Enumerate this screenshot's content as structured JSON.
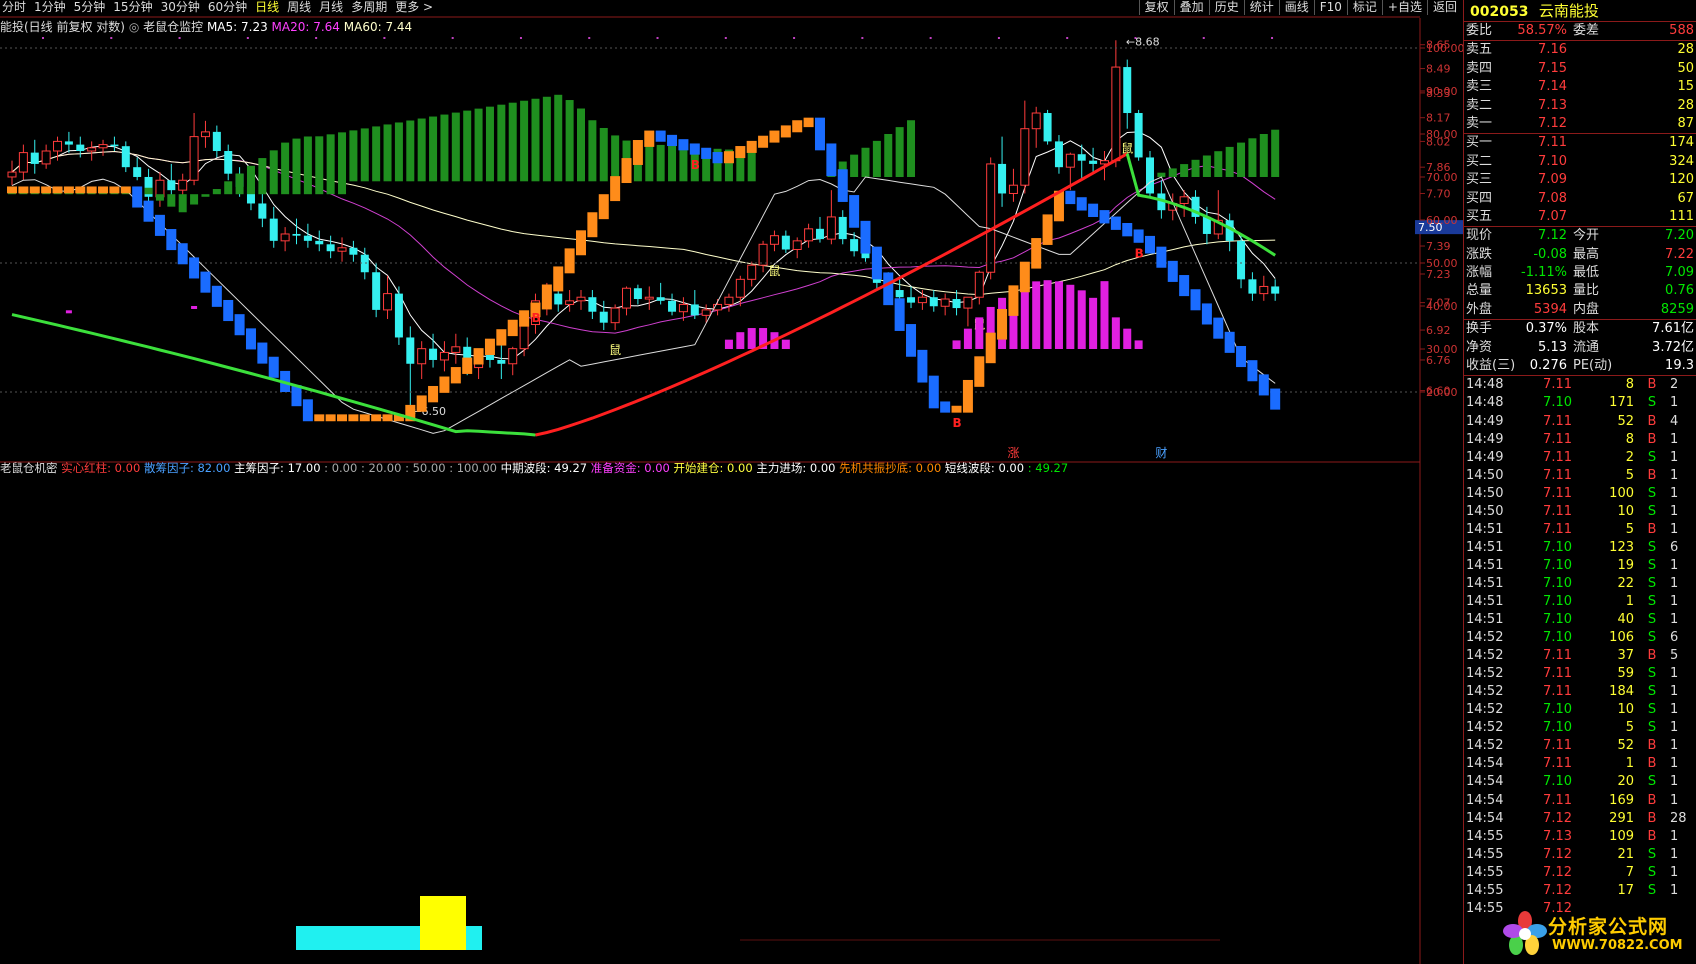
{
  "toolbar": {
    "periods": [
      "分时",
      "1分钟",
      "5分钟",
      "15分钟",
      "30分钟",
      "60分钟",
      "日线",
      "周线",
      "月线",
      "多周期",
      "更多 >"
    ],
    "active_period": "日线",
    "tools": [
      "复权",
      "叠加",
      "历史",
      "统计",
      "画线",
      "F10",
      "标记",
      "+自选",
      "返回"
    ]
  },
  "price_pane": {
    "legend_title": "能投(日线 前复权 对数)",
    "indicator_name": "老鼠仓监控",
    "ma5": "MA5: 7.23",
    "ma20": "MA20: 7.64",
    "ma60": "MA60: 7.44",
    "price_scale": [
      "8.65",
      "8.49",
      "8.33",
      "8.17",
      "8.02",
      "7.86",
      "7.70",
      "7.39",
      "7.23",
      "7.07",
      "6.92",
      "6.76",
      "6.60"
    ],
    "current_price_tag": "7.50",
    "high_marker": "8.68",
    "low_marker": "6.50",
    "mouse_signal_label": "鼠",
    "signal_zhang": "涨",
    "signal_cai": "财"
  },
  "indicator_pane": {
    "title": "老鼠仓机密",
    "params": [
      {
        "label": "实心红柱:",
        "value": "0.00",
        "color": "#ff3c3c"
      },
      {
        "label": "散筹因子:",
        "value": "82.00",
        "color": "#4aa0ff"
      },
      {
        "label": "主筹因子:",
        "value": "17.00",
        "color": "#ffffff"
      },
      {
        "label": ":",
        "value": "0.00",
        "color": "#aaaaaa"
      },
      {
        "label": ":",
        "value": "20.00",
        "color": "#aaaaaa"
      },
      {
        "label": ":",
        "value": "50.00",
        "color": "#aaaaaa"
      },
      {
        "label": ":",
        "value": "100.00",
        "color": "#aaaaaa"
      },
      {
        "label": "中期波段:",
        "value": "49.27",
        "color": "#ffffff"
      },
      {
        "label": "准备资金:",
        "value": "0.00",
        "color": "#ff40ff"
      },
      {
        "label": "开始建仓:",
        "value": "0.00",
        "color": "#ffff40"
      },
      {
        "label": "主力进场:",
        "value": "0.00",
        "color": "#ffffff"
      },
      {
        "label": "先机共振抄底:",
        "value": "0.00",
        "color": "#ff8800"
      },
      {
        "label": "短线波段:",
        "value": "0.00",
        "color": "#ffffff"
      },
      {
        "label": ":",
        "value": "49.27",
        "color": "#00e600"
      }
    ],
    "scale": [
      "100.00",
      "90.00",
      "80.00",
      "70.00",
      "60.00",
      "50.00",
      "40.00",
      "30.00",
      "20.00"
    ],
    "buy_label": "B"
  },
  "chart_data": {
    "type": "candlestick",
    "price_axis": {
      "scale": "log",
      "range": [
        6.45,
        8.75
      ]
    },
    "candles": [
      [
        7.8,
        7.9,
        7.75,
        7.83
      ],
      [
        7.83,
        8.0,
        7.78,
        7.95
      ],
      [
        7.95,
        8.03,
        7.82,
        7.88
      ],
      [
        7.88,
        8.0,
        7.85,
        7.96
      ],
      [
        7.96,
        8.05,
        7.9,
        8.02
      ],
      [
        8.02,
        8.08,
        7.95,
        8.0
      ],
      [
        8.0,
        8.05,
        7.92,
        7.96
      ],
      [
        7.96,
        8.02,
        7.9,
        7.98
      ],
      [
        7.98,
        8.03,
        7.93,
        8.0
      ],
      [
        8.0,
        8.05,
        7.96,
        7.99
      ],
      [
        7.99,
        8.02,
        7.83,
        7.86
      ],
      [
        7.86,
        7.92,
        7.78,
        7.8
      ],
      [
        7.8,
        7.85,
        7.65,
        7.68
      ],
      [
        7.68,
        7.83,
        7.62,
        7.78
      ],
      [
        7.78,
        7.88,
        7.68,
        7.72
      ],
      [
        7.72,
        7.82,
        7.65,
        7.78
      ],
      [
        7.78,
        8.2,
        7.75,
        8.05
      ],
      [
        8.05,
        8.15,
        7.98,
        8.08
      ],
      [
        8.08,
        8.12,
        7.92,
        7.96
      ],
      [
        7.96,
        8.0,
        7.78,
        7.82
      ],
      [
        7.82,
        7.86,
        7.68,
        7.74
      ],
      [
        7.74,
        7.8,
        7.6,
        7.64
      ],
      [
        7.64,
        7.72,
        7.5,
        7.55
      ],
      [
        7.55,
        7.62,
        7.38,
        7.42
      ],
      [
        7.42,
        7.5,
        7.36,
        7.46
      ],
      [
        7.46,
        7.55,
        7.4,
        7.45
      ],
      [
        7.45,
        7.52,
        7.38,
        7.42
      ],
      [
        7.42,
        7.48,
        7.36,
        7.4
      ],
      [
        7.4,
        7.45,
        7.32,
        7.36
      ],
      [
        7.36,
        7.44,
        7.3,
        7.38
      ],
      [
        7.38,
        7.42,
        7.3,
        7.34
      ],
      [
        7.34,
        7.38,
        7.2,
        7.24
      ],
      [
        7.24,
        7.29,
        6.99,
        7.03
      ],
      [
        7.03,
        7.22,
        6.98,
        7.12
      ],
      [
        7.12,
        7.16,
        6.84,
        6.88
      ],
      [
        6.88,
        6.94,
        6.5,
        6.74
      ],
      [
        6.74,
        6.86,
        6.66,
        6.82
      ],
      [
        6.82,
        6.9,
        6.72,
        6.76
      ],
      [
        6.76,
        6.86,
        6.7,
        6.8
      ],
      [
        6.8,
        6.9,
        6.74,
        6.83
      ],
      [
        6.83,
        6.88,
        6.68,
        6.72
      ],
      [
        6.72,
        6.82,
        6.66,
        6.79
      ],
      [
        6.79,
        6.86,
        6.72,
        6.76
      ],
      [
        6.76,
        6.88,
        6.66,
        6.74
      ],
      [
        6.74,
        6.83,
        6.68,
        6.82
      ],
      [
        6.82,
        6.98,
        6.78,
        6.95
      ],
      [
        6.95,
        7.12,
        6.9,
        7.08
      ],
      [
        7.08,
        7.18,
        7.0,
        7.12
      ],
      [
        7.12,
        7.16,
        7.02,
        7.06
      ],
      [
        7.06,
        7.14,
        7.02,
        7.08
      ],
      [
        7.08,
        7.14,
        7.03,
        7.1
      ],
      [
        7.1,
        7.14,
        6.98,
        7.02
      ],
      [
        7.02,
        7.08,
        6.92,
        6.96
      ],
      [
        6.96,
        7.06,
        6.92,
        7.04
      ],
      [
        7.04,
        7.16,
        7.0,
        7.15
      ],
      [
        7.15,
        7.17,
        7.06,
        7.09
      ],
      [
        7.09,
        7.16,
        7.03,
        7.1
      ],
      [
        7.1,
        7.18,
        7.06,
        7.08
      ],
      [
        7.08,
        7.12,
        7.0,
        7.02
      ],
      [
        7.02,
        7.1,
        6.97,
        7.06
      ],
      [
        7.06,
        7.14,
        6.98,
        7.0
      ],
      [
        7.0,
        7.06,
        6.96,
        7.03
      ],
      [
        7.03,
        7.09,
        7.0,
        7.06
      ],
      [
        7.06,
        7.12,
        7.02,
        7.1
      ],
      [
        7.1,
        7.22,
        7.05,
        7.2
      ],
      [
        7.2,
        7.3,
        7.16,
        7.28
      ],
      [
        7.28,
        7.42,
        7.24,
        7.4
      ],
      [
        7.4,
        7.48,
        7.36,
        7.45
      ],
      [
        7.45,
        7.48,
        7.35,
        7.37
      ],
      [
        7.37,
        7.44,
        7.32,
        7.42
      ],
      [
        7.42,
        7.52,
        7.38,
        7.49
      ],
      [
        7.49,
        7.56,
        7.41,
        7.43
      ],
      [
        7.43,
        7.72,
        7.4,
        7.56
      ],
      [
        7.56,
        7.6,
        7.4,
        7.43
      ],
      [
        7.43,
        7.47,
        7.33,
        7.36
      ],
      [
        7.36,
        7.42,
        7.3,
        7.32
      ],
      [
        7.32,
        7.35,
        7.15,
        7.18
      ],
      [
        7.18,
        7.24,
        7.1,
        7.14
      ],
      [
        7.14,
        7.2,
        7.06,
        7.1
      ],
      [
        7.1,
        7.16,
        7.04,
        7.07
      ],
      [
        7.07,
        7.14,
        7.03,
        7.1
      ],
      [
        7.1,
        7.14,
        7.02,
        7.05
      ],
      [
        7.05,
        7.12,
        7.0,
        7.09
      ],
      [
        7.09,
        7.14,
        7.0,
        7.04
      ],
      [
        7.04,
        7.08,
        6.94,
        7.1
      ],
      [
        7.1,
        7.25,
        7.06,
        7.24
      ],
      [
        7.24,
        7.92,
        7.2,
        7.88
      ],
      [
        7.88,
        8.05,
        7.62,
        7.7
      ],
      [
        7.7,
        7.85,
        7.65,
        7.75
      ],
      [
        7.75,
        8.28,
        7.7,
        8.1
      ],
      [
        8.1,
        8.24,
        7.98,
        8.2
      ],
      [
        8.2,
        8.22,
        8.0,
        8.02
      ],
      [
        8.02,
        8.06,
        7.82,
        7.86
      ],
      [
        7.86,
        7.95,
        7.72,
        7.94
      ],
      [
        7.94,
        8.0,
        7.78,
        7.9
      ],
      [
        7.9,
        7.98,
        7.82,
        7.88
      ],
      [
        7.88,
        7.96,
        7.78,
        7.9
      ],
      [
        7.9,
        8.68,
        7.86,
        8.5
      ],
      [
        8.5,
        8.55,
        8.1,
        8.2
      ],
      [
        8.2,
        8.22,
        7.9,
        7.92
      ],
      [
        7.92,
        7.96,
        7.68,
        7.7
      ],
      [
        7.7,
        7.78,
        7.55,
        7.6
      ],
      [
        7.6,
        7.7,
        7.54,
        7.64
      ],
      [
        7.64,
        7.72,
        7.56,
        7.68
      ],
      [
        7.68,
        7.72,
        7.52,
        7.56
      ],
      [
        7.56,
        7.62,
        7.4,
        7.46
      ],
      [
        7.46,
        7.72,
        7.43,
        7.54
      ],
      [
        7.54,
        7.58,
        7.36,
        7.42
      ],
      [
        7.42,
        7.45,
        7.15,
        7.2
      ],
      [
        7.2,
        7.24,
        7.08,
        7.12
      ],
      [
        7.12,
        7.22,
        7.08,
        7.16
      ],
      [
        7.16,
        7.2,
        7.08,
        7.12
      ]
    ],
    "ma_periods": [
      5,
      20,
      60
    ],
    "mouse_signal_index": [
      53,
      67,
      85,
      98
    ],
    "orange_line_buy_index": [
      39,
      89
    ],
    "blue_buy_index": [
      62,
      99
    ]
  },
  "side_panel": {
    "code": "002053",
    "name": "云南能投",
    "weibi_label": "委比",
    "weibi": "58.57%",
    "weicha_label": "委差",
    "weicha": "588",
    "asks": [
      {
        "label": "卖五",
        "price": "7.16",
        "vol": "28"
      },
      {
        "label": "卖四",
        "price": "7.15",
        "vol": "50"
      },
      {
        "label": "卖三",
        "price": "7.14",
        "vol": "15"
      },
      {
        "label": "卖二",
        "price": "7.13",
        "vol": "28"
      },
      {
        "label": "卖一",
        "price": "7.12",
        "vol": "87"
      }
    ],
    "bids": [
      {
        "label": "买一",
        "price": "7.11",
        "vol": "174"
      },
      {
        "label": "买二",
        "price": "7.10",
        "vol": "324"
      },
      {
        "label": "买三",
        "price": "7.09",
        "vol": "120"
      },
      {
        "label": "买四",
        "price": "7.08",
        "vol": "67"
      },
      {
        "label": "买五",
        "price": "7.07",
        "vol": "111"
      }
    ],
    "stats": [
      {
        "l1": "现价",
        "v1": "7.12",
        "c1": "green",
        "l2": "今开",
        "v2": "7.20",
        "c2": "green"
      },
      {
        "l1": "涨跌",
        "v1": "-0.08",
        "c1": "green",
        "l2": "最高",
        "v2": "7.22",
        "c2": "red"
      },
      {
        "l1": "涨幅",
        "v1": "-1.11%",
        "c1": "green",
        "l2": "最低",
        "v2": "7.09",
        "c2": "green"
      },
      {
        "l1": "总量",
        "v1": "13653",
        "c1": "yellow",
        "l2": "量比",
        "v2": "0.76",
        "c2": "green"
      },
      {
        "l1": "外盘",
        "v1": "5394",
        "c1": "red",
        "l2": "内盘",
        "v2": "8259",
        "c2": "green"
      }
    ],
    "stats2": [
      {
        "l1": "换手",
        "v1": "0.37%",
        "l2": "股本",
        "v2": "7.61亿"
      },
      {
        "l1": "净资",
        "v1": "5.13",
        "l2": "流通",
        "v2": "3.72亿"
      },
      {
        "l1": "收益(三)",
        "v1": "0.276",
        "l2": "PE(动)",
        "v2": "19.3"
      }
    ],
    "ticks": [
      [
        "14:48",
        "7.11",
        "8",
        "B",
        "2"
      ],
      [
        "14:48",
        "7.10",
        "171",
        "S",
        "1"
      ],
      [
        "14:49",
        "7.11",
        "52",
        "B",
        "4"
      ],
      [
        "14:49",
        "7.11",
        "8",
        "B",
        "1"
      ],
      [
        "14:49",
        "7.11",
        "2",
        "S",
        "1"
      ],
      [
        "14:50",
        "7.11",
        "5",
        "B",
        "1"
      ],
      [
        "14:50",
        "7.11",
        "100",
        "S",
        "1"
      ],
      [
        "14:50",
        "7.11",
        "10",
        "S",
        "1"
      ],
      [
        "14:51",
        "7.11",
        "5",
        "B",
        "1"
      ],
      [
        "14:51",
        "7.10",
        "123",
        "S",
        "6"
      ],
      [
        "14:51",
        "7.10",
        "19",
        "S",
        "1"
      ],
      [
        "14:51",
        "7.10",
        "22",
        "S",
        "1"
      ],
      [
        "14:51",
        "7.10",
        "1",
        "S",
        "1"
      ],
      [
        "14:51",
        "7.10",
        "40",
        "S",
        "1"
      ],
      [
        "14:52",
        "7.10",
        "106",
        "S",
        "6"
      ],
      [
        "14:52",
        "7.11",
        "37",
        "B",
        "5"
      ],
      [
        "14:52",
        "7.11",
        "59",
        "S",
        "1"
      ],
      [
        "14:52",
        "7.11",
        "184",
        "S",
        "1"
      ],
      [
        "14:52",
        "7.10",
        "10",
        "S",
        "1"
      ],
      [
        "14:52",
        "7.10",
        "5",
        "S",
        "1"
      ],
      [
        "14:52",
        "7.11",
        "52",
        "B",
        "1"
      ],
      [
        "14:54",
        "7.11",
        "1",
        "B",
        "1"
      ],
      [
        "14:54",
        "7.10",
        "20",
        "S",
        "1"
      ],
      [
        "14:54",
        "7.11",
        "169",
        "B",
        "1"
      ],
      [
        "14:54",
        "7.12",
        "291",
        "B",
        "28"
      ],
      [
        "14:55",
        "7.13",
        "109",
        "B",
        "1"
      ],
      [
        "14:55",
        "7.12",
        "21",
        "S",
        "1"
      ],
      [
        "14:55",
        "7.12",
        "7",
        "S",
        "1"
      ],
      [
        "14:55",
        "7.12",
        "17",
        "S",
        "1"
      ],
      [
        "14:55",
        "7.12",
        "",
        "",
        ""
      ]
    ],
    "watermark_cn": "分析家公式网",
    "watermark_url": "WWW.70822.COM"
  }
}
